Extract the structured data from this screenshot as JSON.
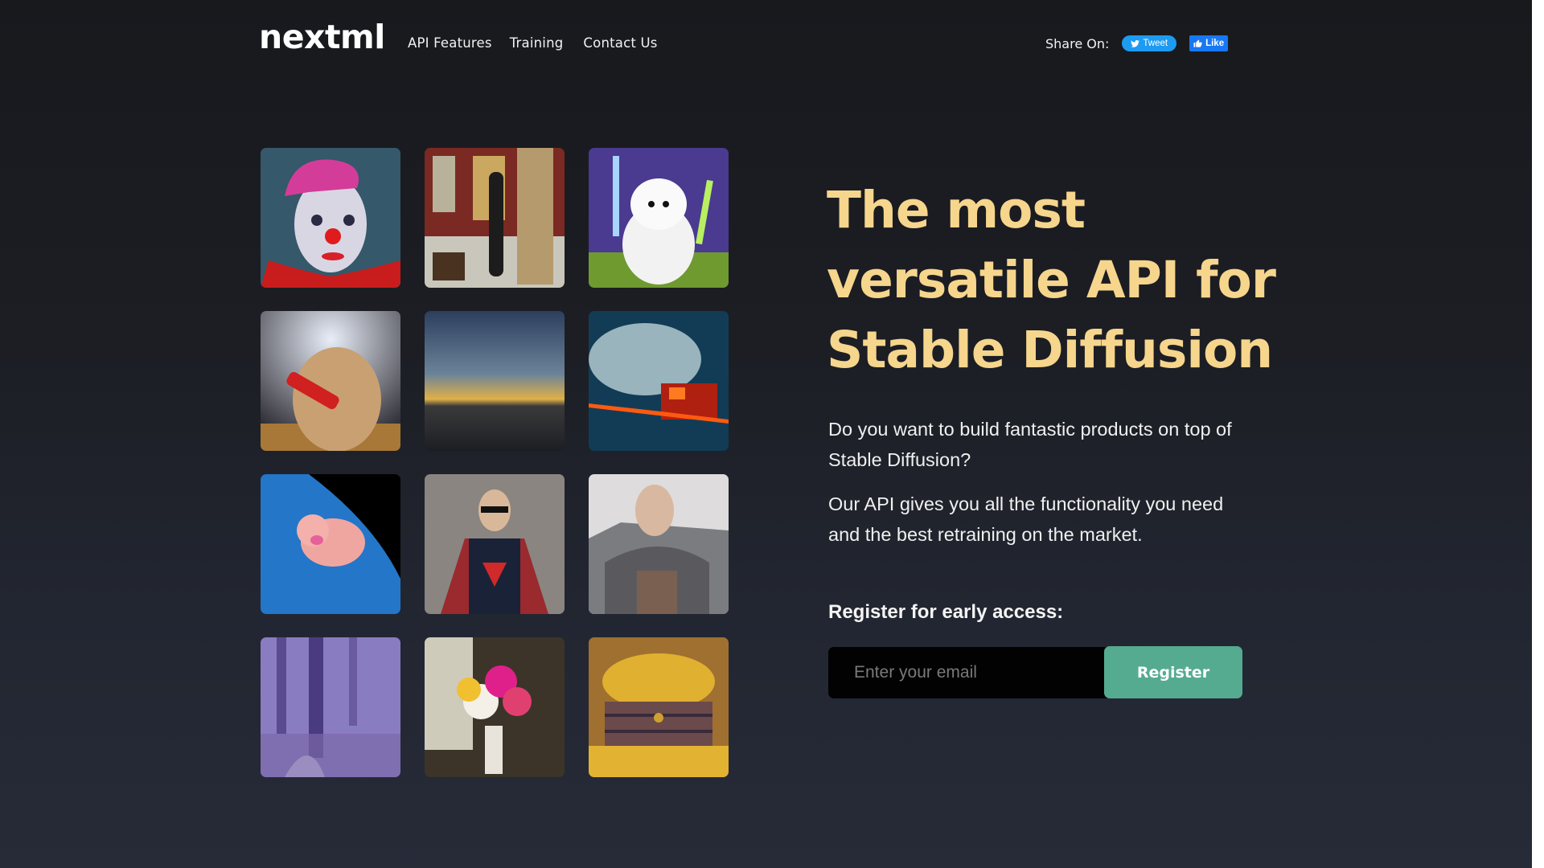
{
  "header": {
    "logo": "nextml",
    "nav": [
      {
        "label": "API Features"
      },
      {
        "label": "Training"
      },
      {
        "label": "Contact Us"
      }
    ],
    "share_label": "Share On:",
    "tweet_label": "Tweet",
    "like_label": "Like"
  },
  "gallery": {
    "images": [
      {
        "name": "clown-portrait",
        "caption": "Clown with pink hair"
      },
      {
        "name": "surreal-interior",
        "caption": "Surreal painting interior"
      },
      {
        "name": "westie-lightsabers",
        "caption": "Westie with lightsabers"
      },
      {
        "name": "hamster-dynamite",
        "caption": "Hamster holding dynamite"
      },
      {
        "name": "sea-sunset",
        "caption": "Night sky over the sea"
      },
      {
        "name": "burning-firetruck",
        "caption": "Fire truck in smoky forest"
      },
      {
        "name": "pig-in-space",
        "caption": "Pig flying above Earth"
      },
      {
        "name": "superman-street",
        "caption": "Superman on city street"
      },
      {
        "name": "armored-warrior",
        "caption": "Woman in armor"
      },
      {
        "name": "futuristic-city",
        "caption": "Purple futuristic city"
      },
      {
        "name": "flower-bouquet",
        "caption": "Bouquet of flowers by window"
      },
      {
        "name": "treasure-chest",
        "caption": "Treasure chest of gold coins"
      }
    ]
  },
  "hero": {
    "headline": "The most versatile API for Stable Diffusion",
    "paragraph1": "Do you want to build fantastic products on top of Stable Diffusion?",
    "paragraph2": "Our API gives you all the functionality you need and the best retraining on the market.",
    "register_label": "Register for early access:",
    "email_placeholder": "Enter your email",
    "email_value": "",
    "register_button": "Register"
  },
  "colors": {
    "headline": "#f6d58d",
    "accent_button": "#55ab90",
    "tweet": "#1d9bf0",
    "facebook": "#1877f2"
  }
}
